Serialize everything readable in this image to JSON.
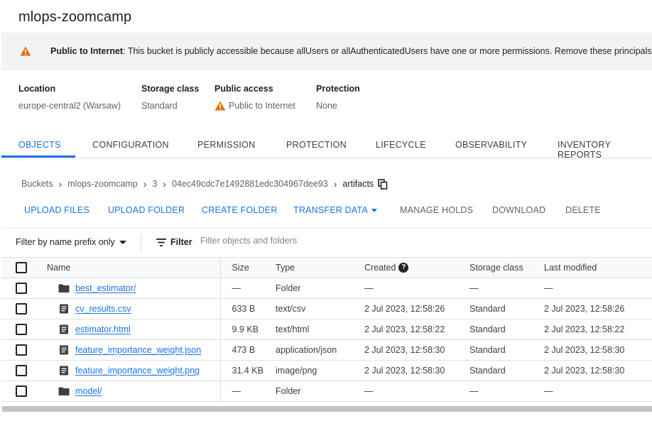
{
  "bucket": {
    "title": "mlops-zoomcamp"
  },
  "banner": {
    "bold": "Public to Internet",
    "text": ": This bucket is publicly accessible because allUsers or allAuthenticatedUsers have one or more permissions. Remove these principals"
  },
  "info": {
    "location": {
      "label": "Location",
      "value": "europe-central2 (Warsaw)"
    },
    "storage_class": {
      "label": "Storage class",
      "value": "Standard"
    },
    "public_access": {
      "label": "Public access",
      "value": "Public to Internet"
    },
    "protection": {
      "label": "Protection",
      "value": "None"
    }
  },
  "tabs": [
    "OBJECTS",
    "CONFIGURATION",
    "PERMISSION",
    "PROTECTION",
    "LIFECYCLE",
    "OBSERVABILITY",
    "INVENTORY REPORTS"
  ],
  "breadcrumb": [
    "Buckets",
    "mlops-zoomcamp",
    "3",
    "04ec49cdc7e1492881edc304967dee93",
    "artifacts"
  ],
  "actions": {
    "upload_files": "UPLOAD FILES",
    "upload_folder": "UPLOAD FOLDER",
    "create_folder": "CREATE FOLDER",
    "transfer_data": "TRANSFER DATA",
    "manage_holds": "MANAGE HOLDS",
    "download": "DOWNLOAD",
    "delete": "DELETE"
  },
  "filter": {
    "prefix_label": "Filter by name prefix only",
    "label": "Filter",
    "placeholder": "Filter objects and folders"
  },
  "table": {
    "columns": [
      "Name",
      "Size",
      "Type",
      "Created",
      "Storage class",
      "Last modified"
    ],
    "rows": [
      {
        "icon": "folder-icon",
        "name": "best_estimator/",
        "size": "—",
        "type": "Folder",
        "created": "—",
        "storage_class": "—",
        "last_modified": "—"
      },
      {
        "icon": "file-icon",
        "name": "cv_results.csv",
        "size": "633 B",
        "type": "text/csv",
        "created": "2 Jul 2023, 12:58:26",
        "storage_class": "Standard",
        "last_modified": "2 Jul 2023, 12:58:26"
      },
      {
        "icon": "file-icon",
        "name": "estimator.html",
        "size": "9.9 KB",
        "type": "text/html",
        "created": "2 Jul 2023, 12:58:22",
        "storage_class": "Standard",
        "last_modified": "2 Jul 2023, 12:58:22"
      },
      {
        "icon": "file-icon",
        "name": "feature_importance_weight.json",
        "size": "473 B",
        "type": "application/json",
        "created": "2 Jul 2023, 12:58:30",
        "storage_class": "Standard",
        "last_modified": "2 Jul 2023, 12:58:30"
      },
      {
        "icon": "file-icon",
        "name": "feature_importance_weight.png",
        "size": "31.4 KB",
        "type": "image/png",
        "created": "2 Jul 2023, 12:58:30",
        "storage_class": "Standard",
        "last_modified": "2 Jul 2023, 12:58:30"
      },
      {
        "icon": "folder-icon",
        "name": "model/",
        "size": "—",
        "type": "Folder",
        "created": "—",
        "storage_class": "—",
        "last_modified": "—"
      }
    ]
  },
  "colors": {
    "accent": "#1a73e8",
    "warning": "#e37400",
    "banner_bg": "#f1f3f4"
  }
}
